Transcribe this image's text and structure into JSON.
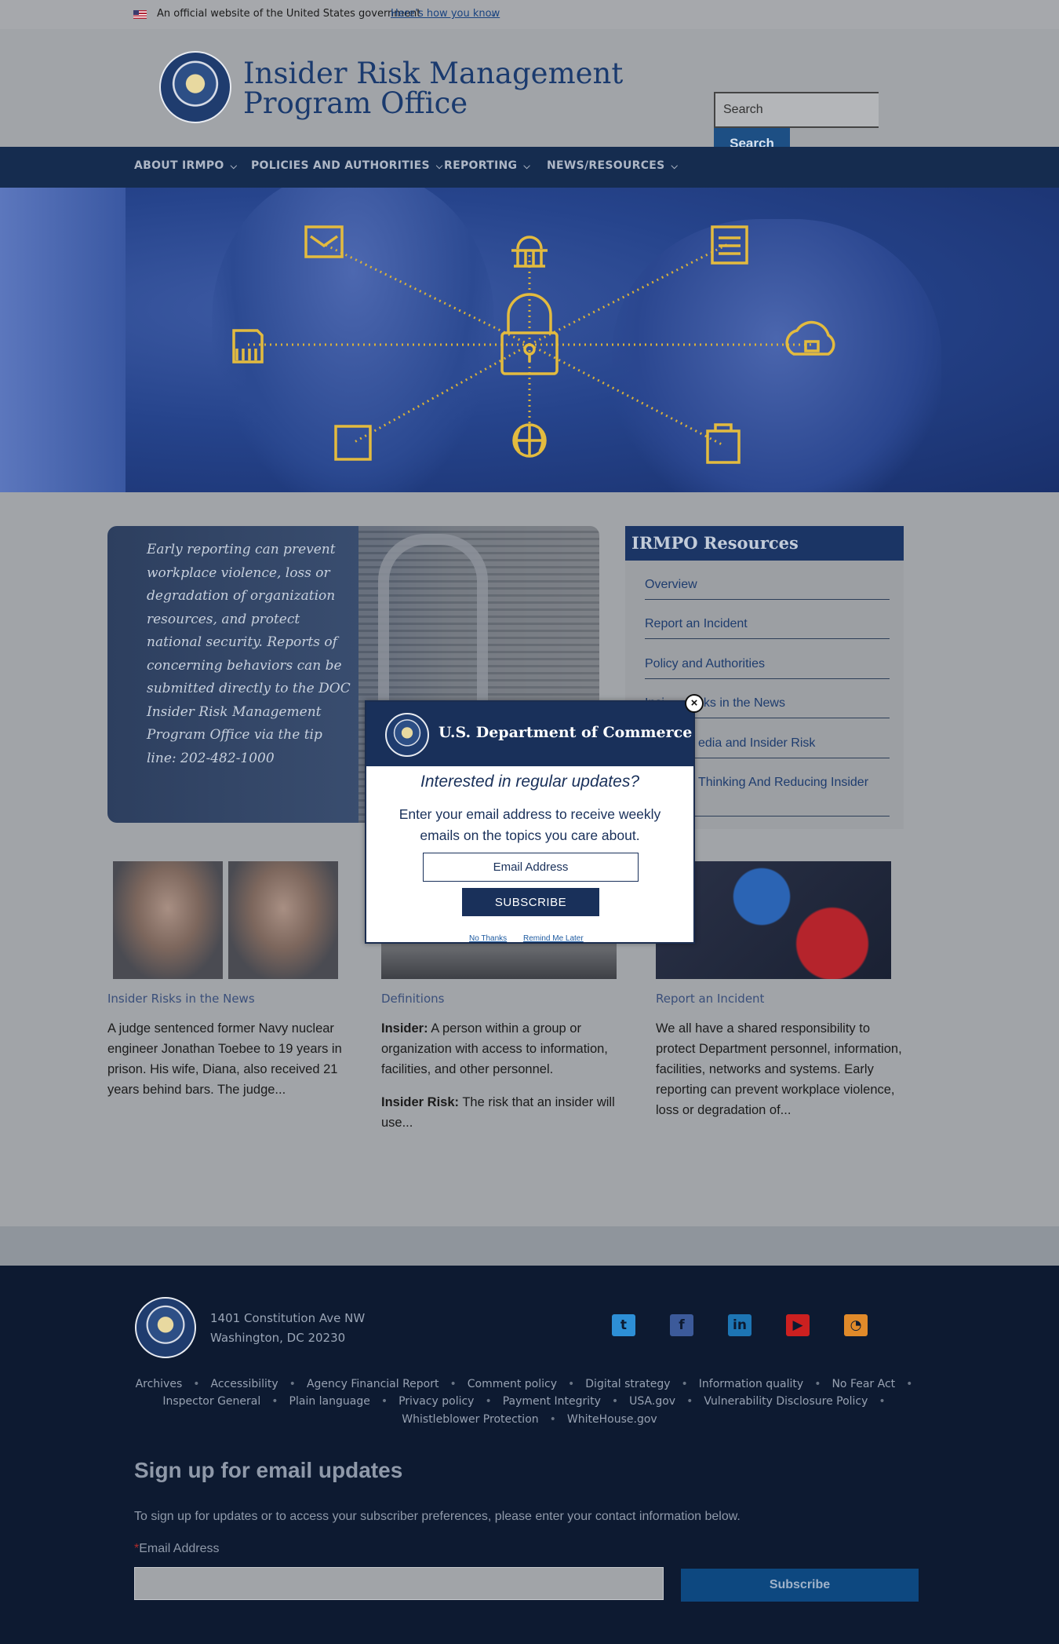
{
  "gov_banner": {
    "text": "An official website of the United States government",
    "link": "Here’s how you know"
  },
  "header": {
    "title_line1": "Insider Risk Management",
    "title_line2": "Program Office",
    "search_placeholder": "Search",
    "search_button": "Search"
  },
  "nav": {
    "items": [
      {
        "label": "ABOUT IRMPO"
      },
      {
        "label": "POLICIES AND AUTHORITIES"
      },
      {
        "label": "REPORTING"
      },
      {
        "label": "NEWS/RESOURCES"
      }
    ]
  },
  "promo": {
    "text": "Early reporting can prevent workplace violence, loss or degradation of organization resources, and protect national security. Reports of concerning behaviors can be submitted directly to the DOC Insider Risk Management Program Office via the tip line: 202-482-1000"
  },
  "resources": {
    "title": "IRMPO Resources",
    "links": [
      "Overview",
      "Report an Incident",
      "Policy and Authorities",
      "Insider Risks in the News",
      "Social Media and Insider Risk",
      "Critical Thinking And Reducing Insider Risk"
    ],
    "visible_links": [
      "Overview",
      "Report an Incident",
      "Policy and Authorities",
      "Insi",
      "sks in the News",
      "edia and Insider Risk",
      "Thinking And Reducing Insider"
    ]
  },
  "cards": [
    {
      "label": "Insider Risks in the News",
      "text": "A judge sentenced former Navy nuclear engineer Jonathan Toebee to 19 years in prison. His wife, Diana, also received 21 years behind bars. The judge..."
    },
    {
      "label": "Definitions",
      "term1": "Insider:",
      "def1": " A person within a group or organization with access to information, facilities, and other personnel.",
      "term2": "Insider Risk:",
      "def2": " The risk that an insider will use..."
    },
    {
      "label": "Report an Incident",
      "text": "We all have a shared responsibility to protect Department personnel, information, facilities, networks and systems.  Early reporting can prevent workplace violence, loss or degradation of..."
    }
  ],
  "modal": {
    "title": "U.S. Department of Commerce",
    "question": "Interested in regular updates?",
    "description": "Enter your email address to receive weekly emails on the topics you care about.",
    "email_placeholder": "Email Address",
    "subscribe": "SUBSCRIBE",
    "no_thanks": "No Thanks",
    "remind_later": "Remind Me Later",
    "close": "×"
  },
  "footer": {
    "address_line1": "1401 Constitution Ave NW",
    "address_line2": "Washington, DC 20230",
    "social": [
      {
        "name": "twitter-icon",
        "glyph": "t",
        "color": "#2d8fd6"
      },
      {
        "name": "facebook-icon",
        "glyph": "f",
        "color": "#3c5a9a"
      },
      {
        "name": "linkedin-icon",
        "glyph": "in",
        "color": "#1d75b4"
      },
      {
        "name": "youtube-icon",
        "glyph": "▶",
        "color": "#cc2020"
      },
      {
        "name": "rss-icon",
        "glyph": "◔",
        "color": "#e08a2a"
      }
    ],
    "links_row1": [
      "Archives",
      "Accessibility",
      "Agency Financial Report",
      "Comment policy",
      "Digital strategy",
      "Information quality",
      "No Fear Act"
    ],
    "links_row2": [
      "Inspector General",
      "Plain language",
      "Privacy policy",
      "Payment Integrity",
      "USA.gov",
      "Vulnerability Disclosure Policy"
    ],
    "links_row3": [
      "Whistleblower Protection",
      "WhiteHouse.gov"
    ],
    "signup_title": "Sign up for email updates",
    "signup_desc": "To sign up for updates or to access your subscriber preferences, please enter your contact information below.",
    "required_mark": "*",
    "email_label": "Email Address",
    "subscribe": "Subscribe"
  }
}
